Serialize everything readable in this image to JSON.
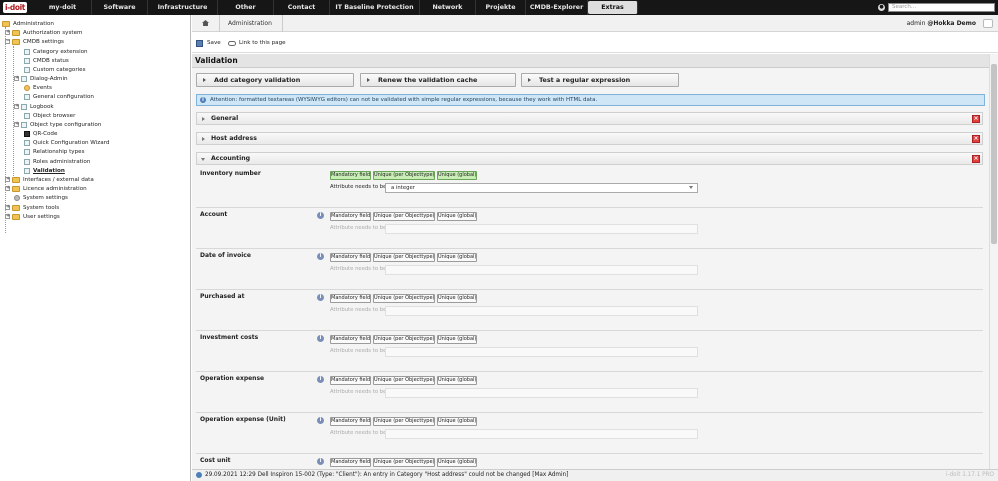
{
  "nav": {
    "logo": "i-doit",
    "items": [
      "my-doit",
      "Software",
      "Infrastructure",
      "Other",
      "Contact",
      "IT Baseline Protection",
      "Network",
      "Projekte",
      "CMDB-Explorer",
      "Extras"
    ],
    "active": "Extras",
    "search_placeholder": "Search..."
  },
  "sidebar": {
    "root": "Administration",
    "items": [
      {
        "label": "Authorization system"
      },
      {
        "label": "CMDB settings"
      },
      {
        "label": "Category extension"
      },
      {
        "label": "CMDB status"
      },
      {
        "label": "Custom categories"
      },
      {
        "label": "Dialog-Admin"
      },
      {
        "label": "Events"
      },
      {
        "label": "General configuration"
      },
      {
        "label": "Logbook"
      },
      {
        "label": "Object browser"
      },
      {
        "label": "Object type configuration"
      },
      {
        "label": "QR-Code"
      },
      {
        "label": "Quick Configuration Wizard"
      },
      {
        "label": "Relationship types"
      },
      {
        "label": "Roles administration"
      },
      {
        "label": "Validation"
      },
      {
        "label": "Interfaces / external data"
      },
      {
        "label": "Licence administration"
      },
      {
        "label": "System settings"
      },
      {
        "label": "System tools"
      },
      {
        "label": "User settings"
      }
    ]
  },
  "breadcrumb": {
    "crumb": "Administration",
    "user": "admin",
    "tenant": "@Hokka Demo"
  },
  "toolbar": {
    "save": "Save",
    "link": "Link to this page"
  },
  "page": {
    "title": "Validation",
    "buttons": [
      "Add category validation",
      "Renew the validation cache",
      "Test a regular expression"
    ],
    "info": "Attention: formatted textareas (WYSIWYG editors) can not be validated with simple regular expressions, because they work with HTML data."
  },
  "sections": {
    "general": "General",
    "host": "Host address",
    "accounting": "Accounting"
  },
  "chips": {
    "mandatory": "Mandatory field",
    "unique_type": "Unique (per Objecttype)",
    "unique_global": "Unique (global)"
  },
  "need_label": "Attribute needs to be",
  "rows": [
    {
      "label": "Inventory number",
      "value": "a integer"
    },
    {
      "label": "Account"
    },
    {
      "label": "Date of invoice"
    },
    {
      "label": "Purchased at"
    },
    {
      "label": "Investment costs"
    },
    {
      "label": "Operation expense"
    },
    {
      "label": "Operation expense (Unit)"
    },
    {
      "label": "Cost unit"
    }
  ],
  "status": {
    "message": "29.09.2021 12:29 Dell Inspiron 15-002 (Type: \"Client\"): An entry in Category \"Host address\" could not be changed [Max Admin]",
    "version": "i-doit 1.17.1 PRO"
  }
}
